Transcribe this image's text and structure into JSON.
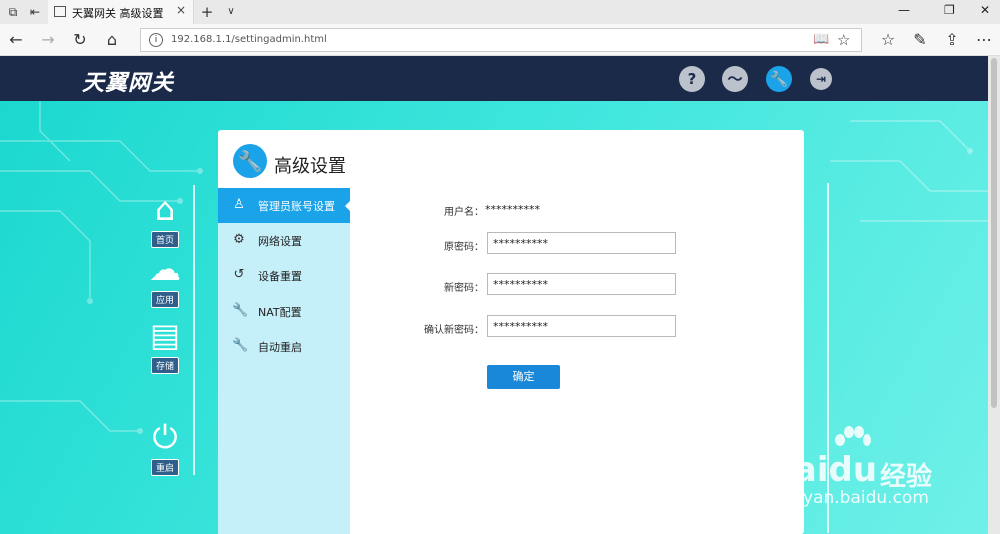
{
  "browser": {
    "tab_title": "天翼网关 高级设置",
    "tab_close": "×",
    "new_tab": "+",
    "tab_menu": "∨",
    "url": "192.168.1.1/settingadmin.html",
    "min": "—",
    "max": "❐",
    "close": "✕"
  },
  "header": {
    "logo_text": "天翼网关",
    "icons": [
      "help-icon",
      "network-icon",
      "settings-wrench-icon",
      "logout-icon"
    ]
  },
  "rail": {
    "items": [
      {
        "label": "首页",
        "icon": "home-icon"
      },
      {
        "label": "应用",
        "icon": "cloud-icon"
      },
      {
        "label": "存储",
        "icon": "storage-icon"
      },
      {
        "label": "重启",
        "icon": "power-icon"
      }
    ]
  },
  "panel": {
    "title": "高级设置",
    "nav": [
      {
        "label": "管理员账号设置",
        "icon": "user-icon"
      },
      {
        "label": "网络设置",
        "icon": "gear-icon"
      },
      {
        "label": "设备重置",
        "icon": "reset-icon"
      },
      {
        "label": "NAT配置",
        "icon": "wrench-icon"
      },
      {
        "label": "自动重启",
        "icon": "wrench-icon"
      }
    ],
    "form": {
      "username_label": "用户名：",
      "username_value": "**********",
      "old_password_label": "原密码：",
      "old_password_value": "**********",
      "new_password_label": "新密码：",
      "new_password_value": "**********",
      "confirm_password_label": "确认新密码：",
      "confirm_password_value": "**********",
      "submit_label": "确定"
    }
  },
  "watermark": {
    "brand": "Bai",
    "brand2": "du",
    "cn": "经验",
    "url": "jingyan.baidu.com"
  },
  "colors": {
    "header_bg": "#1c2a4a",
    "accent": "#1aa3e8",
    "nav_bg": "#c6f0f9",
    "button": "#1a88d8"
  }
}
